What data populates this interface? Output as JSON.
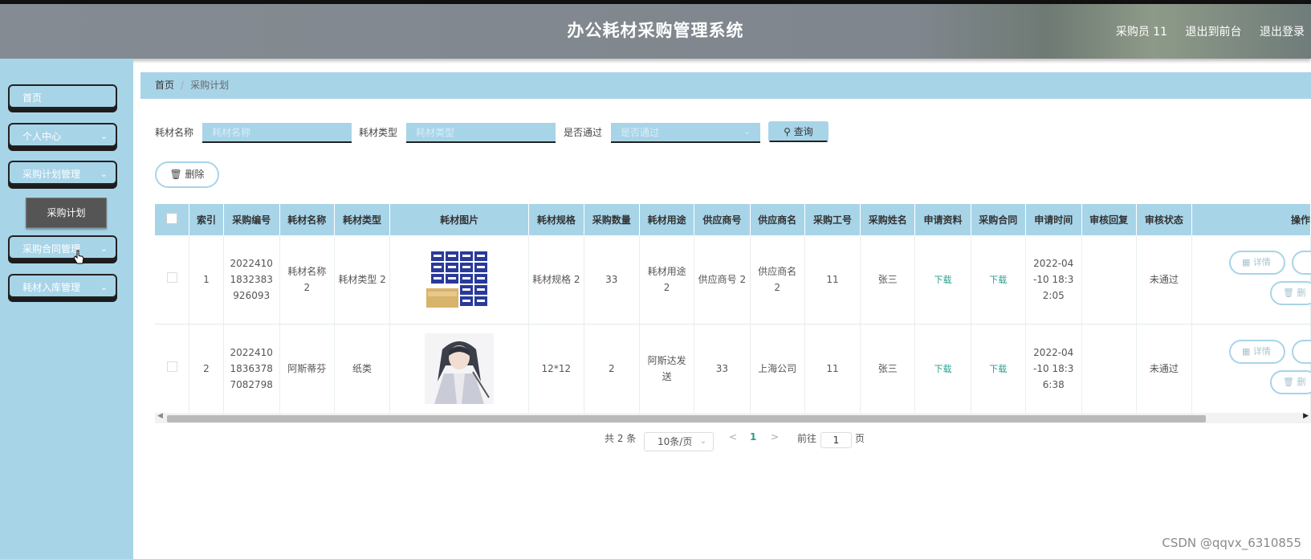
{
  "header": {
    "title": "办公耗材采购管理系统",
    "user": "采购员 11",
    "back_to_front": "退出到前台",
    "logout": "退出登录"
  },
  "sidebar": {
    "items": [
      {
        "label": "首页"
      },
      {
        "label": "个人中心"
      },
      {
        "label": "采购计划管理"
      },
      {
        "label": "采购合同管理"
      },
      {
        "label": "耗材入库管理"
      }
    ],
    "submenu_active": "采购计划"
  },
  "breadcrumb": {
    "home": "首页",
    "current": "采购计划"
  },
  "search": {
    "name_label": "耗材名称",
    "name_placeholder": "耗材名称",
    "type_label": "耗材类型",
    "type_placeholder": "耗材类型",
    "pass_label": "是否通过",
    "pass_placeholder": "是否通过",
    "query_button": "查询"
  },
  "toolbar": {
    "delete_button": "删除"
  },
  "table": {
    "columns": [
      "索引",
      "采购编号",
      "耗材名称",
      "耗材类型",
      "耗材图片",
      "耗材规格",
      "采购数量",
      "耗材用途",
      "供应商号",
      "供应商名",
      "采购工号",
      "采购姓名",
      "申请资料",
      "采购合同",
      "申请时间",
      "审核回复",
      "审核状态",
      "操作"
    ],
    "rows": [
      {
        "index": "1",
        "code": "2022410 1832383 926093",
        "name": "耗材名称 2",
        "type": "耗材类型 2",
        "image": "tissue-box-image",
        "spec": "耗材规格 2",
        "qty": "33",
        "usage": "耗材用途 2",
        "supplier_no": "供应商号 2",
        "supplier_name": "供应商名 2",
        "staff_no": "11",
        "staff_name": "张三",
        "apply_doc": "下载",
        "contract": "下载",
        "apply_time": "2022-04 -10 18:3 2:05",
        "reply": "",
        "status": "未通过",
        "detail_btn": "详情",
        "delete_btn": "删"
      },
      {
        "index": "2",
        "code": "2022410 1836378 7082798",
        "name": "阿斯蒂芬",
        "type": "纸类",
        "image": "character-illustration-image",
        "spec": "12*12",
        "qty": "2",
        "usage": "阿斯达发 送",
        "supplier_no": "33",
        "supplier_name": "上海公司",
        "staff_no": "11",
        "staff_name": "张三",
        "apply_doc": "下载",
        "contract": "下载",
        "apply_time": "2022-04 -10 18:3 6:38",
        "reply": "",
        "status": "未通过",
        "detail_btn": "详情",
        "delete_btn": "删"
      }
    ]
  },
  "pagination": {
    "total": "共 2 条",
    "page_size": "10条/页",
    "current_page": "1",
    "goto_label": "前往",
    "goto_value": "1",
    "page_suffix": "页"
  },
  "watermark": "CSDN @qqvx_6310855",
  "colors": {
    "accent": "#a8d4e8",
    "header": "#848b92",
    "link_green": "#2a9d8f"
  }
}
